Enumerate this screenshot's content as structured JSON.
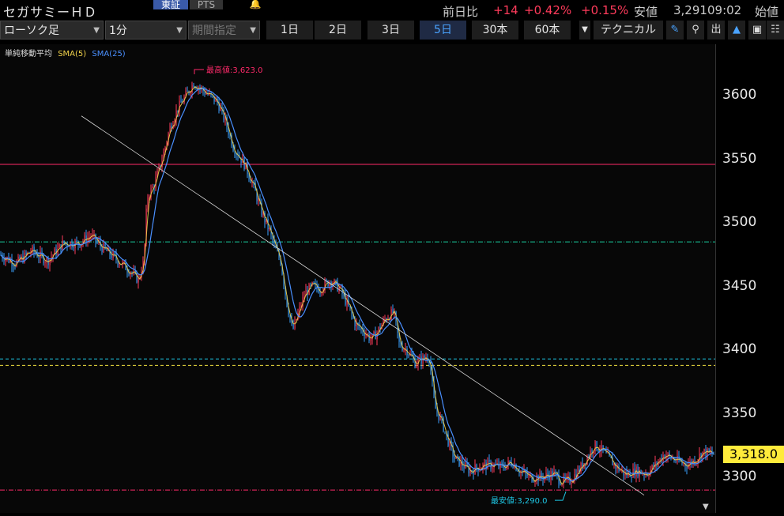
{
  "header": {
    "title": "セガサミーＨＤ",
    "market_tab": "東証",
    "pts_tab": "PTS",
    "prev_day_label": "前日比",
    "change": "+14",
    "change_pct": "+0.42%",
    "change_pct2": "+0.15%",
    "low_label": "安値",
    "low_value": "3,291",
    "time": "09:02",
    "open_label": "始値"
  },
  "toolbar": {
    "chart_type": "ローソク足",
    "interval": "1分",
    "period": "期間指定",
    "timeframes": [
      "1日",
      "2日",
      "3日",
      "5日",
      "30本",
      "60本"
    ],
    "active_timeframe": "5日",
    "technical": "テクニカル",
    "out_label": "出"
  },
  "colors": {
    "up": "#ff3b5b",
    "down": "#3aa0ff",
    "sma5": "#f2d34b",
    "sma25": "#4a90ff",
    "resistance": "#ff2a6a",
    "green_line": "#18c79a",
    "cyan_line": "#1ec8e6",
    "yellow_line": "#f0e040",
    "current_price_bg": "#ffeb3b"
  },
  "chart_data": {
    "type": "candlestick",
    "legend": {
      "label": "単純移動平均",
      "sma5": "SMA(5)",
      "sma25": "SMA(25)"
    },
    "y_ticks": [
      3600,
      3550,
      3500,
      3450,
      3400,
      3350,
      3300
    ],
    "ylim": [
      3278,
      3640
    ],
    "high_label": "最高値:3,623.0",
    "high_value": 3623,
    "low_label": "最安値:3,290.0",
    "low_value": 3290,
    "current_price": 3318,
    "current_price_label": "3,318.0",
    "h_lines": [
      {
        "value": 3546,
        "style": "solid",
        "color": "resistance"
      },
      {
        "value": 3485,
        "style": "dashdot",
        "color": "green_line"
      },
      {
        "value": 3393,
        "style": "dash",
        "color": "cyan_line"
      },
      {
        "value": 3388,
        "style": "dash",
        "color": "yellow_line"
      },
      {
        "value": 3290,
        "style": "dashdot",
        "color": "resistance"
      }
    ],
    "trendline": {
      "from_value": 3584,
      "to_value": 3286
    },
    "anchors": [
      [
        0,
        3475
      ],
      [
        20,
        3468
      ],
      [
        40,
        3478
      ],
      [
        60,
        3470
      ],
      [
        80,
        3484
      ],
      [
        100,
        3484
      ],
      [
        115,
        3490
      ],
      [
        130,
        3480
      ],
      [
        150,
        3470
      ],
      [
        165,
        3462
      ],
      [
        175,
        3455
      ],
      [
        182,
        3470
      ],
      [
        186,
        3520
      ],
      [
        195,
        3530
      ],
      [
        205,
        3550
      ],
      [
        215,
        3575
      ],
      [
        225,
        3590
      ],
      [
        235,
        3600
      ],
      [
        245,
        3610
      ],
      [
        255,
        3605
      ],
      [
        265,
        3600
      ],
      [
        275,
        3595
      ],
      [
        285,
        3580
      ],
      [
        295,
        3560
      ],
      [
        310,
        3545
      ],
      [
        320,
        3530
      ],
      [
        330,
        3510
      ],
      [
        340,
        3495
      ],
      [
        348,
        3480
      ],
      [
        355,
        3470
      ],
      [
        362,
        3440
      ],
      [
        370,
        3415
      ],
      [
        378,
        3430
      ],
      [
        386,
        3445
      ],
      [
        395,
        3450
      ],
      [
        405,
        3448
      ],
      [
        418,
        3455
      ],
      [
        430,
        3448
      ],
      [
        440,
        3435
      ],
      [
        450,
        3420
      ],
      [
        460,
        3415
      ],
      [
        470,
        3408
      ],
      [
        478,
        3415
      ],
      [
        488,
        3425
      ],
      [
        498,
        3430
      ],
      [
        505,
        3405
      ],
      [
        515,
        3400
      ],
      [
        525,
        3390
      ],
      [
        535,
        3393
      ],
      [
        543,
        3395
      ],
      [
        550,
        3355
      ],
      [
        558,
        3345
      ],
      [
        566,
        3330
      ],
      [
        575,
        3315
      ],
      [
        585,
        3310
      ],
      [
        595,
        3305
      ],
      [
        605,
        3308
      ],
      [
        620,
        3310
      ],
      [
        635,
        3308
      ],
      [
        648,
        3312
      ],
      [
        658,
        3305
      ],
      [
        670,
        3300
      ],
      [
        685,
        3300
      ],
      [
        700,
        3303
      ],
      [
        712,
        3296
      ],
      [
        722,
        3298
      ],
      [
        732,
        3305
      ],
      [
        742,
        3315
      ],
      [
        752,
        3325
      ],
      [
        760,
        3322
      ],
      [
        770,
        3315
      ],
      [
        780,
        3308
      ],
      [
        792,
        3302
      ],
      [
        805,
        3305
      ],
      [
        818,
        3303
      ],
      [
        830,
        3310
      ],
      [
        840,
        3318
      ],
      [
        850,
        3315
      ],
      [
        860,
        3312
      ],
      [
        870,
        3310
      ],
      [
        880,
        3314
      ],
      [
        890,
        3320
      ],
      [
        903,
        3318
      ]
    ]
  }
}
